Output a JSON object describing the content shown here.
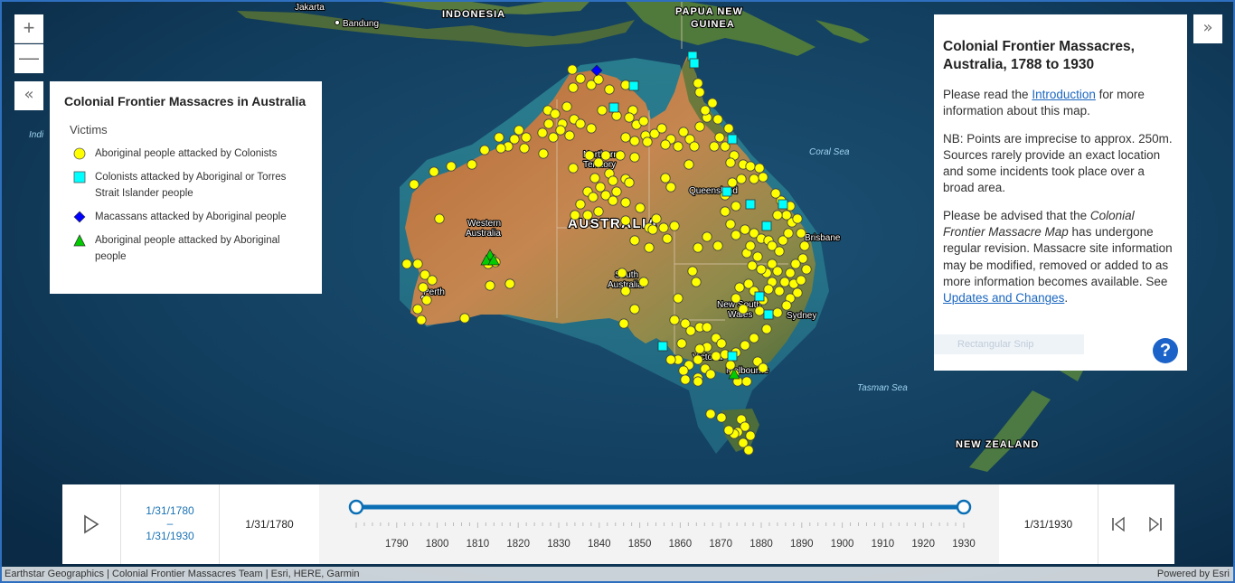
{
  "map": {
    "country_labels": [
      "INDONESIA",
      "PAPUA NEW GUINEA",
      "AUSTRALIA",
      "NEW ZEALAND"
    ],
    "state_labels": [
      "Northern Territory",
      "Queensland",
      "Western Australia",
      "South Australia",
      "New South Wales",
      "Victoria"
    ],
    "city_labels": [
      "Jakarta",
      "Bandung",
      "Perth",
      "Brisbane",
      "Sydney",
      "Melbourne"
    ],
    "sea_labels": [
      "Coral Sea",
      "Tasman Sea",
      "Indi"
    ]
  },
  "zoom": {
    "in_label": "+",
    "out_label": "—"
  },
  "legend": {
    "title": "Colonial Frontier Massacres in Australia",
    "subtitle": "Victims",
    "items": [
      {
        "label": "Aboriginal people attacked by Colonists",
        "symbol": "yellow-circle",
        "color": "#ffff00"
      },
      {
        "label": "Colonists attacked by Aboriginal or Torres Strait Islander people",
        "symbol": "cyan-square",
        "color": "#00ffff"
      },
      {
        "label": "Macassans attacked by Aboriginal people",
        "symbol": "blue-diamond",
        "color": "#0000ff"
      },
      {
        "label": "Aboriginal people attacked by Aboriginal people",
        "symbol": "green-triangle",
        "color": "#00cc00"
      }
    ]
  },
  "info": {
    "title": "Colonial Frontier Massacres, Australia, 1788 to 1930",
    "p1_before": "Please read the ",
    "p1_link": "Introduction",
    "p1_after": " for more information about this map.",
    "p2": "NB: Points are imprecise to approx. 250m. Sources rarely provide an exact location and some incidents took place over a broad area.",
    "p3_before": "Please be advised that the ",
    "p3_italic": "Colonial Frontier Massacre Map",
    "p3_after": " has undergone regular revision. Massacre site information may be modified, removed or added to as more information becomes available. See ",
    "p3_link": "Updates and Changes",
    "p3_end": ".",
    "ghost_label": "Rectangular Snip",
    "help_label": "?"
  },
  "timeslider": {
    "range_start": "1/31/1780",
    "range_sep": "–",
    "range_end": "1/31/1930",
    "start_label": "1/31/1780",
    "end_label": "1/31/1930",
    "tick_labels": [
      "1790",
      "1800",
      "1810",
      "1820",
      "1830",
      "1840",
      "1850",
      "1860",
      "1870",
      "1880",
      "1890",
      "1900",
      "1910",
      "1920",
      "1930"
    ],
    "range_years": [
      1780,
      1930
    ]
  },
  "attribution": {
    "text": "Earthstar Geographics | Colonial Frontier Massacres Team | Esri, HERE, Garmin",
    "powered": "Powered by Esri"
  },
  "colors": {
    "yellow": "#ffff00",
    "cyan": "#00ffff",
    "blue": "#0000ff",
    "green": "#00cc00",
    "slider_blue": "#0a6fb5"
  },
  "icons": [
    "plus-icon",
    "minus-icon",
    "double-chevron-left-icon",
    "double-chevron-right-icon",
    "play-icon",
    "previous-icon",
    "next-icon",
    "help-icon"
  ]
}
